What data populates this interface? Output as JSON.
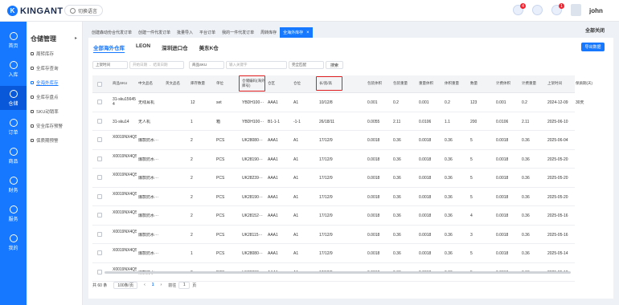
{
  "header": {
    "logo_text": "KINGANT",
    "language_button": "切换语言",
    "badges": [
      "4",
      "1"
    ],
    "username": "john"
  },
  "sidebar": {
    "items": [
      "首页",
      "入库",
      "仓储",
      "订单",
      "商品",
      "财务",
      "服务",
      "我的"
    ],
    "active_index": 2
  },
  "submenu": {
    "title": "仓储管理",
    "items": [
      "周转库存",
      "全库存查询",
      "全海外库存",
      "全库存盘点",
      "SKU动销率",
      "安全库存预警",
      "保质期预警"
    ],
    "active_index": 2
  },
  "tabs": {
    "items": [
      "创建森动份合代发订单",
      "创建一件代发订单",
      "批量导入",
      "平台订单",
      "我的一件代发订单",
      "周转库存",
      "全海外库存"
    ],
    "active_index": 6,
    "close_all": "全部关闭"
  },
  "warehouse_tabs": [
    "全部海外仓库",
    "LEON",
    "深圳进口仓",
    "美东K仓"
  ],
  "export_button": "导出数据",
  "filters": {
    "time_type": "上架时间",
    "start_placeholder": "开始日期",
    "separator": "-",
    "end_placeholder": "结束日期",
    "sku_type": "商品SKU",
    "input_placeholder": "输入关键字",
    "match_mode": "完全匹配",
    "search_button": "搜索"
  },
  "table": {
    "headers": [
      "商品SKU",
      "中文品名",
      "英文品名",
      "库存数量",
      "单位",
      "仓储编码(海外库号)",
      "仓区",
      "仓位",
      "长/宽/高",
      "包装体积",
      "包装重量",
      "重量体积",
      "体积重量",
      "数量",
      "计费体积",
      "计费重量",
      "上架时间",
      "保质期(天)"
    ],
    "rows": [
      [
        "31-sku15645 4",
        "无线耳机",
        "",
        "12",
        "set",
        "YBDH100···",
        "AAA1",
        "A1",
        "10/12/8",
        "0.001",
        "0.2",
        "0.001",
        "0.2",
        "123",
        "0.001",
        "0.2",
        "2024-12-09",
        "30天"
      ],
      [
        "31-sku14",
        "无人机",
        "",
        "1",
        "箱",
        "YBDH100···",
        "B1-1-1",
        "-1-1",
        "26/18/11",
        "0.0055",
        "2.11",
        "0.0106",
        "1.1",
        "200",
        "0.0106",
        "2.11",
        "2025-06-10",
        ""
      ],
      [
        "X0019NX4Q5",
        "爆款防水···",
        "",
        "2",
        "PCS",
        "UK28080···",
        "AAA1",
        "A1",
        "17/12/9",
        "0.0018",
        "0.36",
        "0.0018",
        "0.36",
        "5",
        "0.0018",
        "0.36",
        "2025-06-04",
        ""
      ],
      [
        "X0019NX4Q5",
        "爆款防水···",
        "",
        "2",
        "PCS",
        "UK28190···",
        "AAA1",
        "A1",
        "17/12/9",
        "0.0018",
        "0.36",
        "0.0018",
        "0.36",
        "5",
        "0.0018",
        "0.36",
        "2025-05-20",
        ""
      ],
      [
        "X0019NX4Q5",
        "爆款防水···",
        "",
        "2",
        "PCS",
        "UK28239···",
        "AAA1",
        "A1",
        "17/12/9",
        "0.0018",
        "0.36",
        "0.0018",
        "0.36",
        "5",
        "0.0018",
        "0.36",
        "2025-05-20",
        ""
      ],
      [
        "X0019NX4Q5",
        "爆款防水···",
        "",
        "2",
        "PCS",
        "UK28190···",
        "AAA1",
        "A1",
        "17/12/9",
        "0.0018",
        "0.36",
        "0.0018",
        "0.36",
        "5",
        "0.0018",
        "0.36",
        "2025-05-20",
        ""
      ],
      [
        "X0019NX4Q5",
        "爆款防水···",
        "",
        "2",
        "PCS",
        "UK28152···",
        "AAA1",
        "A1",
        "17/12/9",
        "0.0018",
        "0.36",
        "0.0018",
        "0.36",
        "4",
        "0.0018",
        "0.36",
        "2025-05-16",
        ""
      ],
      [
        "X0019NX4Q5",
        "爆款防水···",
        "",
        "2",
        "PCS",
        "UK28115···",
        "AAA1",
        "A1",
        "17/12/9",
        "0.0018",
        "0.36",
        "0.0018",
        "0.36",
        "3",
        "0.0018",
        "0.36",
        "2025-05-16",
        ""
      ],
      [
        "X0019NX4Q5",
        "爆款防水···",
        "",
        "1",
        "PCS",
        "UK28080···",
        "AAA1",
        "A1",
        "17/12/9",
        "0.0018",
        "0.36",
        "0.0018",
        "0.36",
        "5",
        "0.0018",
        "0.36",
        "2025-05-14",
        ""
      ],
      [
        "X0019NX4Q5",
        "爆款防水···",
        "",
        "2",
        "PCS",
        "UK28080···",
        "AAA1",
        "A1",
        "17/12/9",
        "0.0018",
        "0.36",
        "0.0018",
        "0.36",
        "5",
        "0.0018",
        "0.36",
        "2025-05-18",
        ""
      ]
    ]
  },
  "pagination": {
    "total": "共 60 条",
    "page_size": "100条/页",
    "prev": "‹",
    "current": "1",
    "next": "›",
    "goto_label": "前往",
    "goto_value": "1",
    "page_suffix": "页"
  },
  "colors": {
    "accent": "#1677ff",
    "highlight": "#e02020"
  }
}
